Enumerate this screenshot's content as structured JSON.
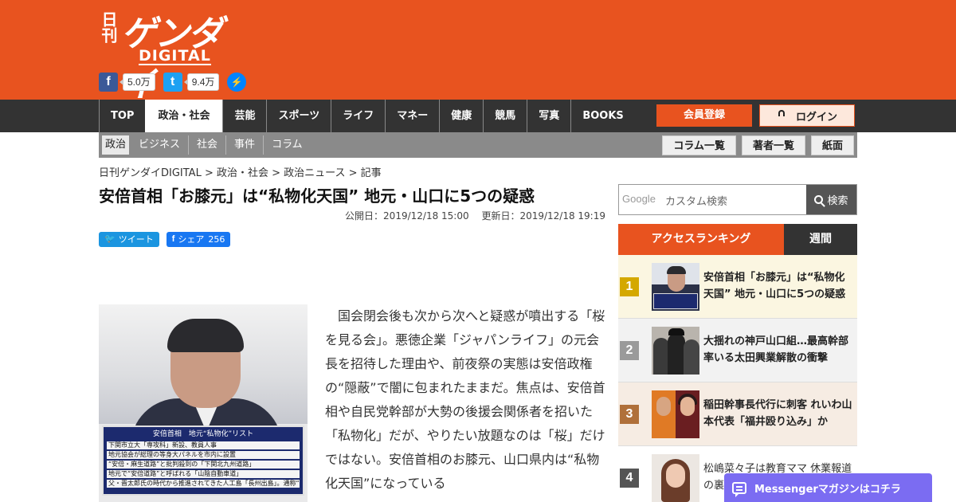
{
  "brand": {
    "logo_small": "日刊",
    "logo_big": "ゲンダイ",
    "logo_sub": "DIGITAL",
    "accent_color": "#e8531f"
  },
  "social": {
    "facebook_icon": "facebook-icon",
    "facebook_count": "5.0万",
    "twitter_icon": "twitter-icon",
    "twitter_count": "9.4万",
    "messenger_icon": "messenger-icon"
  },
  "nav": {
    "items": [
      "TOP",
      "政治・社会",
      "芸能",
      "スポーツ",
      "ライフ",
      "マネー",
      "健康",
      "競馬",
      "写真",
      "BOOKS"
    ],
    "active_index": 1,
    "register_label": "会員登録",
    "login_label": "ログイン"
  },
  "subnav": {
    "items": [
      "政治",
      "ビジネス",
      "社会",
      "事件",
      "コラム"
    ],
    "buttons": [
      "コラム一覧",
      "著者一覧",
      "紙面"
    ]
  },
  "breadcrumb": "日刊ゲンダイDIGITAL > 政治・社会 > 政治ニュース > 記事",
  "article": {
    "title": "安倍首相「お膝元」は“私物化天国” 地元・山口に5つの疑惑",
    "published": "公開日：2019/12/18 15:00",
    "updated": "更新日：2019/12/18 19:19",
    "tweet_label": "ツイート",
    "share_label": "シェア",
    "share_count": "256",
    "body": "国会閉会後も次から次へと疑惑が噴出する「桜を見る会」。悪徳企業「ジャパンライフ」の元会長を招待した理由や、前夜祭の実態は安倍政権の“隠蔽”で闇に包まれたままだ。焦点は、安倍首相や自民党幹部が大勢の後援会関係者を招いた「私物化」だが、やりたい放題なのは「桜」だけではない。安倍首相のお膝元、山口県内は“私物化天国”になっている",
    "photo": {
      "panel_title": "安倍首相　地元“私物化”リスト",
      "panel_lines": [
        "下関市立大「専攻科」新設、教員人事",
        "地元協会が総理の等身大パネルを市内に設置",
        "“安倍・麻生道路”と批判殺到の「下関北九州道路」",
        "地元で“安倍道路”と呼ばれる「山陰自動車道」",
        "父・晋太郎氏の時代から推進されてきた人工島「長州出島」。通称“安倍アイランド”"
      ]
    }
  },
  "sidebar": {
    "search_brand": "Google",
    "search_placeholder": "カスタム検索",
    "search_button": "検索",
    "tab_ranking": "アクセスランキング",
    "tab_weekly": "週間",
    "ranking": [
      {
        "rank": "1",
        "color": "#d4a800",
        "bg": "#fbf6e1",
        "text": "安倍首相「お膝元」は“私物化天国” 地元・山口に5つの疑惑"
      },
      {
        "rank": "2",
        "color": "#9a9a9a",
        "bg": "#f2f2f2",
        "text": "大揺れの神戸山口組…最高幹部率いる太田興業解散の衝撃"
      },
      {
        "rank": "3",
        "color": "#b0703a",
        "bg": "#f6ece3",
        "text": "稲田幹事長代行に刺客 れいわ山本代表「福井殴り込み」か"
      },
      {
        "rank": "4",
        "color": "#555555",
        "bg": "#ffffff",
        "text": "松嶋菜々子は教育ママ 休業報道の裏"
      }
    ]
  },
  "messenger_bar": {
    "label": "Messengerマガジンはコチラ"
  }
}
